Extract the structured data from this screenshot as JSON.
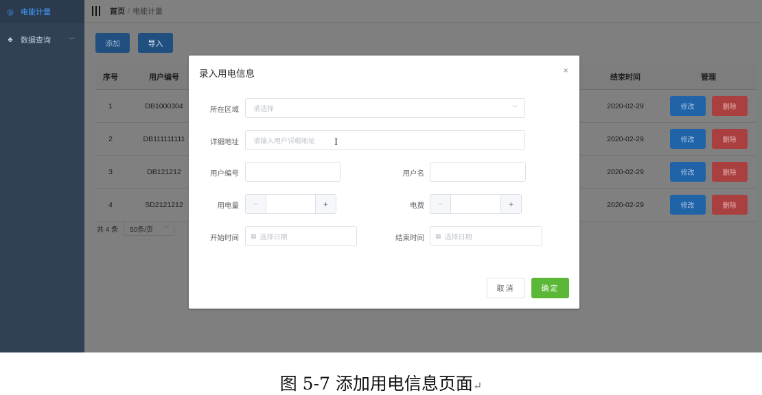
{
  "sidebar": {
    "items": [
      {
        "label": "电能计量",
        "icon": "circle-icon"
      },
      {
        "label": "数据查询",
        "icon": "sitemap-icon"
      }
    ]
  },
  "navbar": {
    "home": "首页",
    "separator": "/",
    "current": "电能计量"
  },
  "toolbar": {
    "add_label": "添加",
    "import_label": "导入"
  },
  "table": {
    "headers": {
      "index": "序号",
      "user_id": "用户编号",
      "end_time": "结束时间",
      "manage": "管理"
    },
    "rows": [
      {
        "index": "1",
        "user_id": "DB1000304",
        "end_time": "2020-02-29"
      },
      {
        "index": "2",
        "user_id": "DB111111111",
        "end_time": "2020-02-29"
      },
      {
        "index": "3",
        "user_id": "DB121212",
        "end_time": "2020-02-29"
      },
      {
        "index": "4",
        "user_id": "SD2121212",
        "end_time": "2020-02-29"
      }
    ],
    "edit_label": "修改",
    "delete_label": "删除"
  },
  "pagination": {
    "total": "共 4 条",
    "page_size": "50条/页"
  },
  "dialog": {
    "title": "录入用电信息",
    "close": "×",
    "region_label": "所在区域",
    "region_placeholder": "请选择",
    "address_label": "详细地址",
    "address_placeholder": "请输入用户详细地址",
    "user_id_label": "用户编号",
    "username_label": "用户名",
    "usage_label": "用电量",
    "fee_label": "电费",
    "start_label": "开始时间",
    "end_label": "结束时间",
    "date_placeholder": "选择日期",
    "cancel_label": "取消",
    "confirm_label": "确定"
  },
  "caption": {
    "text": "图 5-7 添加用电信息页面"
  }
}
